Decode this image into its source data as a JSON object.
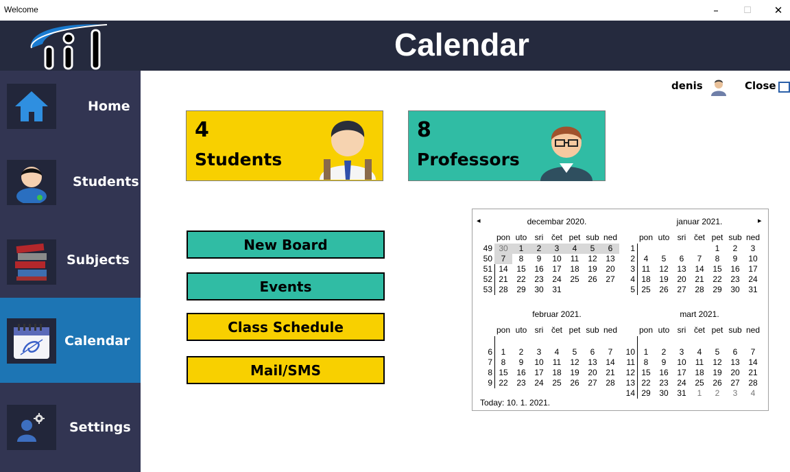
{
  "window": {
    "title": "Welcome",
    "minimize": "–",
    "maximize": "☐",
    "close": "✕"
  },
  "header": {
    "title": "Calendar"
  },
  "sidebar": {
    "items": [
      {
        "label": "Home",
        "icon": "home-icon"
      },
      {
        "label": "Students",
        "icon": "student-icon"
      },
      {
        "label": "Subjects",
        "icon": "books-icon"
      },
      {
        "label": "Calendar",
        "icon": "calendar-icon",
        "active": true
      },
      {
        "label": "Settings",
        "icon": "settings-icon"
      }
    ]
  },
  "userbar": {
    "username": "denis",
    "close_label": "Close"
  },
  "cards": [
    {
      "count": "4",
      "label": "Students",
      "color": "#f8d000"
    },
    {
      "count": "8",
      "label": "Professors",
      "color": "#30bca4"
    }
  ],
  "buttons": [
    {
      "label": "New Board",
      "color": "#30bca4"
    },
    {
      "label": "Events",
      "color": "#30bca4"
    },
    {
      "label": "Class Schedule",
      "color": "#f8d000"
    },
    {
      "label": "Mail/SMS",
      "color": "#f8d000"
    }
  ],
  "calendar": {
    "prev": "◂",
    "next": "▸",
    "weekdays": [
      "pon",
      "uto",
      "sri",
      "čet",
      "pet",
      "sub",
      "ned"
    ],
    "today": "Today: 10. 1. 2021.",
    "months": [
      {
        "title": "decembar 2020.",
        "weeks": [
          "49",
          "50",
          "51",
          "52",
          "53"
        ],
        "rows": [
          [
            "30",
            "1",
            "2",
            "3",
            "4",
            "5",
            "6"
          ],
          [
            "7",
            "8",
            "9",
            "10",
            "11",
            "12",
            "13"
          ],
          [
            "14",
            "15",
            "16",
            "17",
            "18",
            "19",
            "20"
          ],
          [
            "21",
            "22",
            "23",
            "24",
            "25",
            "26",
            "27"
          ],
          [
            "28",
            "29",
            "30",
            "31",
            "",
            "",
            ""
          ]
        ]
      },
      {
        "title": "januar 2021.",
        "weeks": [
          "1",
          "2",
          "3",
          "4",
          "5"
        ],
        "rows": [
          [
            "",
            "",
            "",
            "",
            "1",
            "2",
            "3"
          ],
          [
            "4",
            "5",
            "6",
            "7",
            "8",
            "9",
            "10"
          ],
          [
            "11",
            "12",
            "13",
            "14",
            "15",
            "16",
            "17"
          ],
          [
            "18",
            "19",
            "20",
            "21",
            "22",
            "23",
            "24"
          ],
          [
            "25",
            "26",
            "27",
            "28",
            "29",
            "30",
            "31"
          ]
        ]
      },
      {
        "title": "februar 2021.",
        "weeks": [
          "6",
          "7",
          "8",
          "9"
        ],
        "rows": [
          [
            "1",
            "2",
            "3",
            "4",
            "5",
            "6",
            "7"
          ],
          [
            "8",
            "9",
            "10",
            "11",
            "12",
            "13",
            "14"
          ],
          [
            "15",
            "16",
            "17",
            "18",
            "19",
            "20",
            "21"
          ],
          [
            "22",
            "23",
            "24",
            "25",
            "26",
            "27",
            "28"
          ]
        ]
      },
      {
        "title": "mart 2021.",
        "weeks": [
          "10",
          "11",
          "12",
          "13",
          "14"
        ],
        "rows": [
          [
            "1",
            "2",
            "3",
            "4",
            "5",
            "6",
            "7"
          ],
          [
            "8",
            "9",
            "10",
            "11",
            "12",
            "13",
            "14"
          ],
          [
            "15",
            "16",
            "17",
            "18",
            "19",
            "20",
            "21"
          ],
          [
            "22",
            "23",
            "24",
            "25",
            "26",
            "27",
            "28"
          ],
          [
            "29",
            "30",
            "31",
            "1",
            "2",
            "3",
            "4"
          ]
        ]
      }
    ]
  }
}
